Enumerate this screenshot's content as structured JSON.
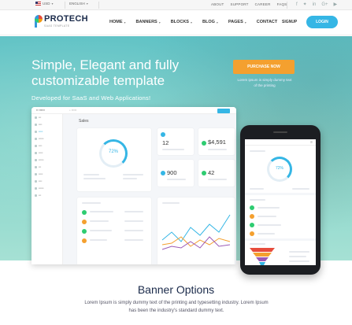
{
  "topbar": {
    "currency": "USD",
    "language": "ENGLISH",
    "links": [
      "ABOUT",
      "SUPPORT",
      "CAREER",
      "FAQS"
    ],
    "social_icons": [
      "facebook-icon",
      "twitter-icon",
      "linkedin-icon",
      "google-plus-icon",
      "youtube-icon"
    ]
  },
  "nav": {
    "logo_title": "PROTECH",
    "logo_sub": "SAAS TEMPLATE",
    "menu": [
      "HOME",
      "BANNERS",
      "BLOCKS",
      "BLOG",
      "PAGES",
      "CONTACT"
    ],
    "signup": "SIGNUP",
    "login": "LOGIN"
  },
  "hero": {
    "title": "Simple, Elegant and fully customizable template",
    "subtitle": "Developed for SaaS and Web Applications!",
    "purchase_button": "PURCHASE NOW",
    "purchase_note": "Lorem ipsum is simply dummy text of the printing"
  },
  "dashboard": {
    "page_title": "Sales",
    "ring_percent": "72%",
    "stats": [
      {
        "value": "12"
      },
      {
        "value": "$4,591"
      },
      {
        "value": "900"
      },
      {
        "value": "42"
      }
    ]
  },
  "phone": {
    "ring_percent": "72%"
  },
  "section": {
    "title": "Banner Options",
    "text": "Lorem Ipsum is simply dummy text of the printing and typesetting industry. Lorem Ipsum has been the industry's standard dummy text."
  },
  "colors": {
    "accent": "#35b6e5",
    "orange": "#f4a02f",
    "hero_teal": "#5fc2c5"
  }
}
